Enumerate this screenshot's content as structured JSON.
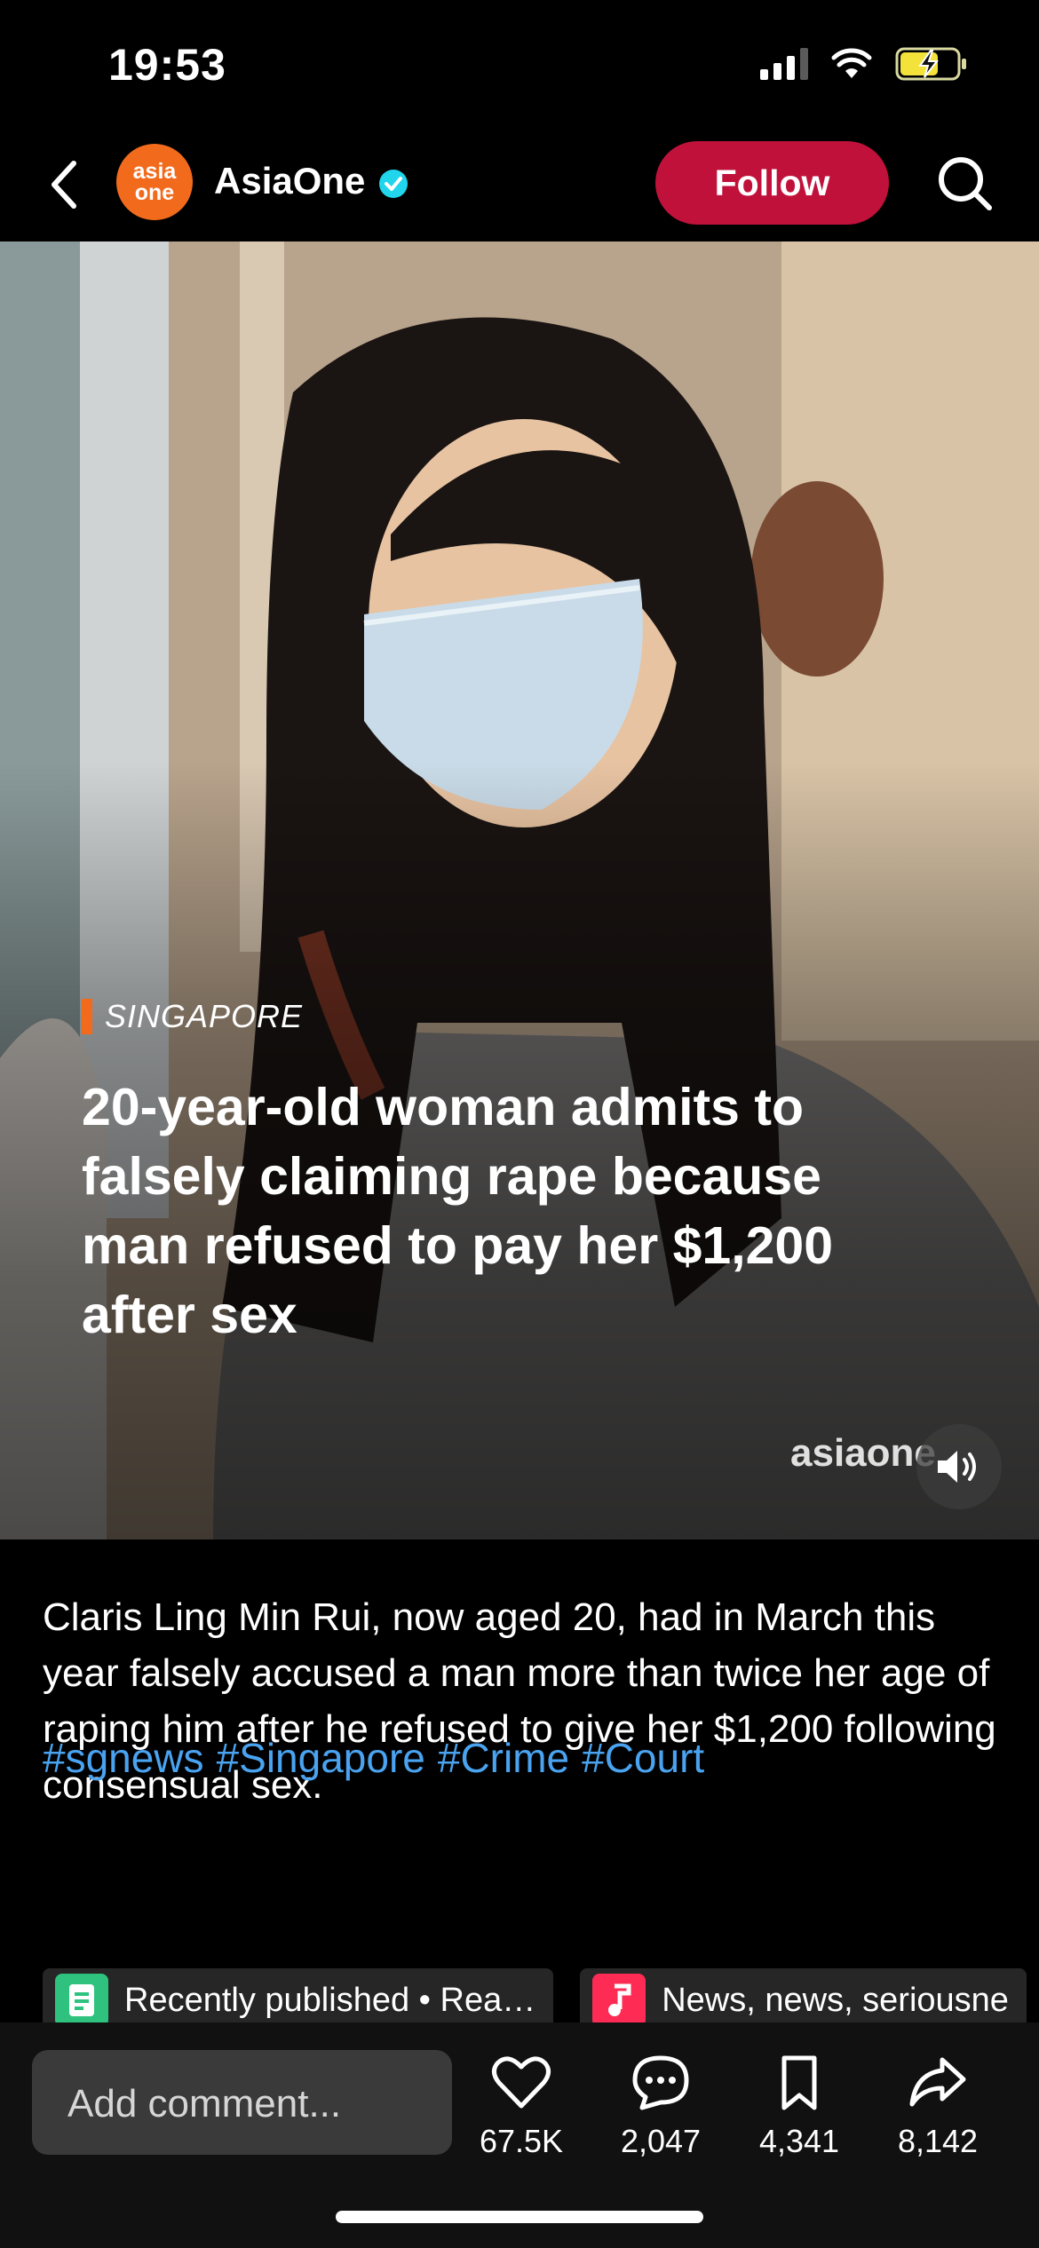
{
  "status_bar": {
    "time": "19:53"
  },
  "header": {
    "channel_name": "AsiaOne",
    "avatar_text_top": "asia",
    "avatar_text_bottom": "one",
    "follow_label": "Follow"
  },
  "video": {
    "category": "SINGAPORE",
    "headline": "20-year-old woman admits to falsely claiming rape because man refused to pay her $1,200 after sex",
    "watermark": "asiaone"
  },
  "post": {
    "description": "Claris Ling Min Rui, now aged 20, had in March this year falsely accused a man more than twice her age of raping him after he refused to give her $1,200 following consensual sex.",
    "hashtags": [
      "#sgnews",
      "#Singapore",
      "#Crime",
      "#Court"
    ],
    "chips": [
      {
        "label": "Recently published • Rea…",
        "icon": "document-icon",
        "color": "#2ec27e"
      },
      {
        "label": "News, news, seriousne",
        "icon": "music-note-icon",
        "color": "#fe2c55"
      }
    ]
  },
  "bottom_bar": {
    "comment_placeholder": "Add comment...",
    "likes": "67.5K",
    "comments": "2,047",
    "saves": "4,341",
    "shares": "8,142"
  },
  "colors": {
    "follow": "#c0113b",
    "brand_orange": "#f26b1d",
    "hashtag": "#4aa3f0",
    "verified": "#20d5ec"
  }
}
